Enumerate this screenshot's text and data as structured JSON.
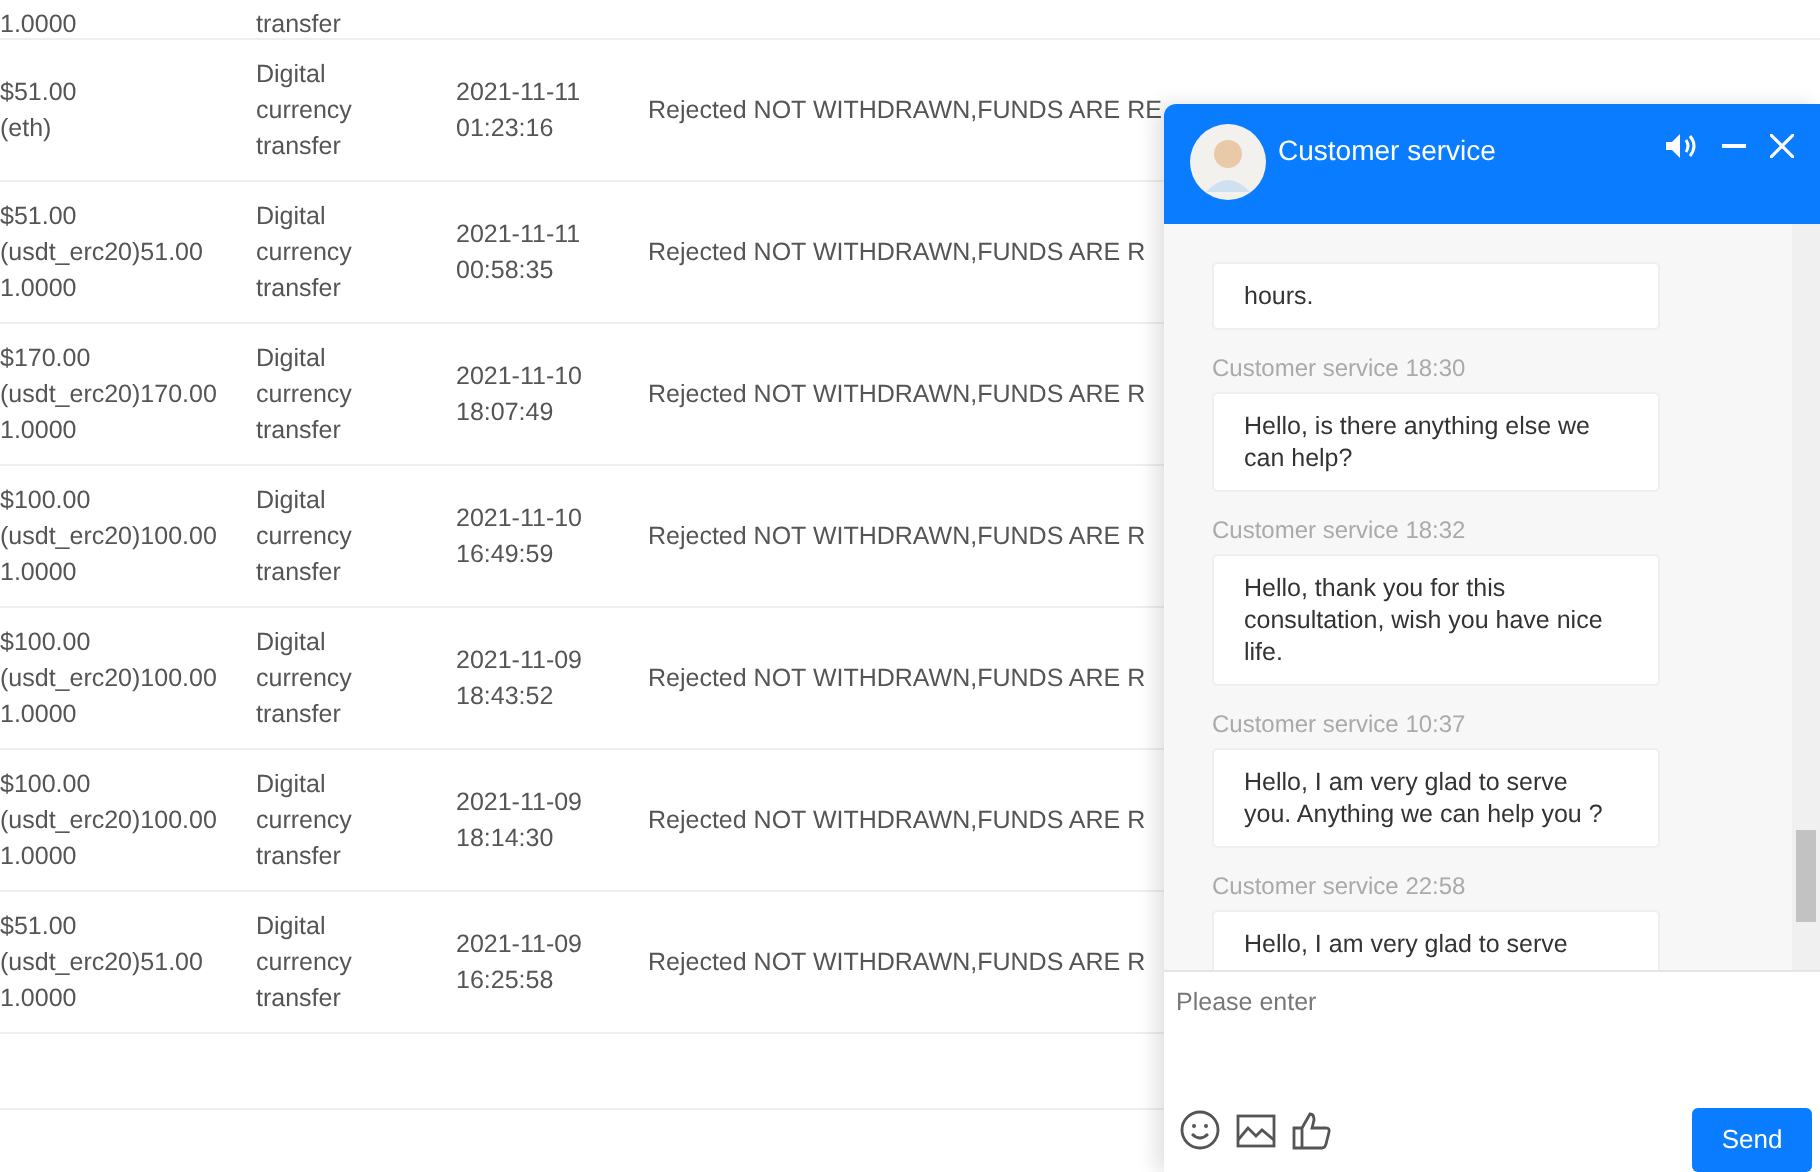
{
  "table": {
    "partial_row": {
      "amount": "1.0000",
      "type": "transfer"
    },
    "rows": [
      {
        "amount": [
          "$51.00",
          "(eth)"
        ],
        "type": [
          "Digital",
          "currency",
          "transfer"
        ],
        "time": [
          "2021-11-11",
          "01:23:16"
        ],
        "status": "Rejected NOT WITHDRAWN,FUNDS ARE RE"
      },
      {
        "amount": [
          "$51.00",
          "(usdt_erc20)51.00",
          "1.0000"
        ],
        "type": [
          "Digital",
          "currency",
          "transfer"
        ],
        "time": [
          "2021-11-11",
          "00:58:35"
        ],
        "status": "Rejected NOT WITHDRAWN,FUNDS ARE R"
      },
      {
        "amount": [
          "$170.00",
          "(usdt_erc20)170.00",
          "1.0000"
        ],
        "type": [
          "Digital",
          "currency",
          "transfer"
        ],
        "time": [
          "2021-11-10",
          "18:07:49"
        ],
        "status": "Rejected NOT WITHDRAWN,FUNDS ARE R"
      },
      {
        "amount": [
          "$100.00",
          "(usdt_erc20)100.00",
          "1.0000"
        ],
        "type": [
          "Digital",
          "currency",
          "transfer"
        ],
        "time": [
          "2021-11-10",
          "16:49:59"
        ],
        "status": "Rejected NOT WITHDRAWN,FUNDS ARE R"
      },
      {
        "amount": [
          "$100.00",
          "(usdt_erc20)100.00",
          "1.0000"
        ],
        "type": [
          "Digital",
          "currency",
          "transfer"
        ],
        "time": [
          "2021-11-09",
          "18:43:52"
        ],
        "status": "Rejected NOT WITHDRAWN,FUNDS ARE R"
      },
      {
        "amount": [
          "$100.00",
          "(usdt_erc20)100.00",
          "1.0000"
        ],
        "type": [
          "Digital",
          "currency",
          "transfer"
        ],
        "time": [
          "2021-11-09",
          "18:14:30"
        ],
        "status": "Rejected NOT WITHDRAWN,FUNDS ARE R"
      },
      {
        "amount": [
          "$51.00",
          "(usdt_erc20)51.00",
          "1.0000"
        ],
        "type": [
          "Digital",
          "currency",
          "transfer"
        ],
        "time": [
          "2021-11-09",
          "16:25:58"
        ],
        "status": "Rejected NOT WITHDRAWN,FUNDS ARE R"
      }
    ]
  },
  "chat": {
    "title": "Customer service",
    "messages": [
      {
        "text": "hours."
      },
      {
        "sender": "Customer service 18:30",
        "text": "Hello, is there anything else we can help?"
      },
      {
        "sender": "Customer service 18:32",
        "text": "Hello, thank you for this consultation, wish you have nice life."
      },
      {
        "sender": "Customer service 10:37",
        "text": "Hello, I am very glad to serve you. Anything we can help you ?"
      },
      {
        "sender": "Customer service 22:58",
        "text": "Hello, I am very glad to serve"
      }
    ],
    "input": {
      "placeholder": "Please enter"
    },
    "send": "Send"
  }
}
